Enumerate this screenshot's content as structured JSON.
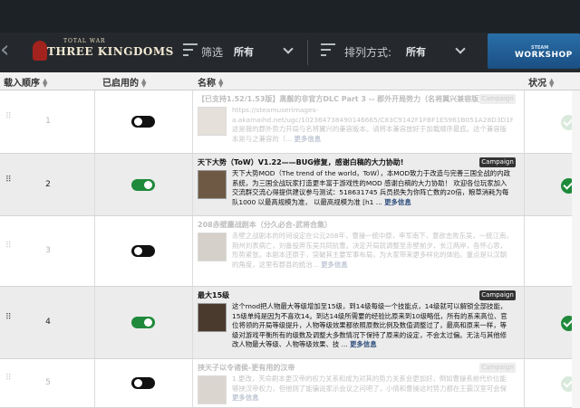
{
  "header_bar": {
    "logo_small": "TOTAL WAR",
    "logo_big": "THREE KINGDOMS",
    "filter_label": "筛选",
    "filter_value": "所有",
    "sort_label": "排列方式:",
    "sort_value": "所有",
    "workshop_small": "STEAM",
    "workshop_label": "WORKSHOP"
  },
  "columns": {
    "order": "载入顺序",
    "enabled": "已启用的",
    "name": "名称",
    "status": "状况"
  },
  "rows": [
    {
      "index": "1",
      "enabled": false,
      "title": "【已支持1.52/1.53版】黑鬍的非官方DLC Part 3 -- 郡外开局势力（名将翼兴兼容版）",
      "badge": "Campaign",
      "desc": "https://steamuserimages-a.akamaihd.net/ugc/102364738490146665/C83C9142F1FBF1E5961B051A28D3D1F63007110D/  这是我的郡外势力开局与名将翼兴的兼容版本。请将本兼容放好于加载顺序最底。这个兼容版本是与之兼容的（...",
      "more": "更多信息",
      "status": "faint"
    },
    {
      "index": "2",
      "enabled": true,
      "title": "天下大势（ToW）V1.22——BUG修复，感谢白稿的大力协助!",
      "badge": "Campaign",
      "desc": "天下大势MOD（The trend of the world，ToW），本MOD致力于改造与完善三国全战的内政系统，为三国全战玩家打造更丰富于游戏性的MOD 感谢白稿的大力协助！ 欢迎各位玩家加入交流群交流心得提供建议参与测试：518631745 兵员损失为你阵亡数的20倍，粮草消耗为每队1000 以最高规模为准， 以最高规模为准 [h1 ...",
      "more": "更多信息",
      "status": "ok"
    },
    {
      "index": "3",
      "enabled": false,
      "title": "208赤壁鏖战剧本（分久必合-武将合集）",
      "badge": "",
      "desc": "赤壁之战剧本的时间设定在公元208年，曹操一统中原，率军南下，意欲击败东吴，一统江南，荆州刘表病亡，刘备投奔东吴共同抗曹。决定开局就调整至赤壁前夕，长江两岸，各怀心思，形势紧张。本剧本还原于，突破其主要军事布局，为大家带来更多样化的体验。重点是以汉朝的角度，这里有郡县的统治...",
      "more": "更多信息",
      "status": ""
    },
    {
      "index": "4",
      "enabled": true,
      "title": "最大15级",
      "badge": "Campaign",
      "desc": "这个mod把人物最大等级增加至15级，到14级每级一个技能点，14级就可以解锁全部技能，15级单纯是因为不喜欢14。到达14级所需要的经验比原来到10级略低，所有的系来高位、官位将领的开局等级提升，人物等级效果都依照原数比例及数值调整过了，最高和原来一样，等级对游戏平衡所有的级数及调整大多数情况下保持了原来的设定，不会太过偏。无法与其他修改人物最大等级、人物等级效果、技 ...",
      "more": "更多信息",
      "status": "ok"
    },
    {
      "index": "5",
      "enabled": false,
      "title": "挟天子以令诸侯-更有用的汉帝",
      "badge": "Campaign",
      "desc": "1.更改，天命刷本更汉帝的权力关系和成为对其的势力关系会更加好，倒如曹操系前代价位能够挟汉帝权力，但他则了能骗说家示会议之问吧了，小倩和曹操这时势力都在王霸汉室可会保",
      "more": "更多信息",
      "status": "faint"
    }
  ]
}
